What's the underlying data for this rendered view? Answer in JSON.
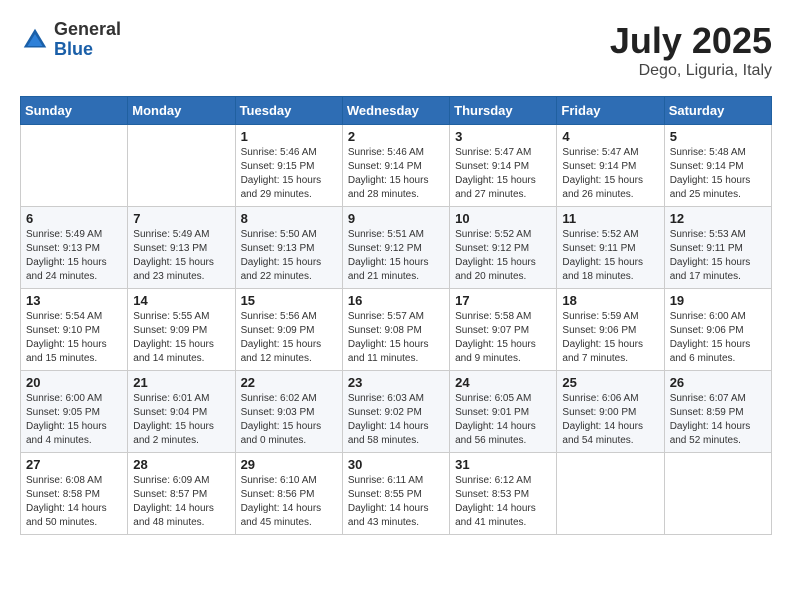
{
  "header": {
    "logo_general": "General",
    "logo_blue": "Blue",
    "main_title": "July 2025",
    "subtitle": "Dego, Liguria, Italy"
  },
  "weekdays": [
    "Sunday",
    "Monday",
    "Tuesday",
    "Wednesday",
    "Thursday",
    "Friday",
    "Saturday"
  ],
  "weeks": [
    [
      {
        "day": "",
        "info": ""
      },
      {
        "day": "",
        "info": ""
      },
      {
        "day": "1",
        "info": "Sunrise: 5:46 AM\nSunset: 9:15 PM\nDaylight: 15 hours and 29 minutes."
      },
      {
        "day": "2",
        "info": "Sunrise: 5:46 AM\nSunset: 9:14 PM\nDaylight: 15 hours and 28 minutes."
      },
      {
        "day": "3",
        "info": "Sunrise: 5:47 AM\nSunset: 9:14 PM\nDaylight: 15 hours and 27 minutes."
      },
      {
        "day": "4",
        "info": "Sunrise: 5:47 AM\nSunset: 9:14 PM\nDaylight: 15 hours and 26 minutes."
      },
      {
        "day": "5",
        "info": "Sunrise: 5:48 AM\nSunset: 9:14 PM\nDaylight: 15 hours and 25 minutes."
      }
    ],
    [
      {
        "day": "6",
        "info": "Sunrise: 5:49 AM\nSunset: 9:13 PM\nDaylight: 15 hours and 24 minutes."
      },
      {
        "day": "7",
        "info": "Sunrise: 5:49 AM\nSunset: 9:13 PM\nDaylight: 15 hours and 23 minutes."
      },
      {
        "day": "8",
        "info": "Sunrise: 5:50 AM\nSunset: 9:13 PM\nDaylight: 15 hours and 22 minutes."
      },
      {
        "day": "9",
        "info": "Sunrise: 5:51 AM\nSunset: 9:12 PM\nDaylight: 15 hours and 21 minutes."
      },
      {
        "day": "10",
        "info": "Sunrise: 5:52 AM\nSunset: 9:12 PM\nDaylight: 15 hours and 20 minutes."
      },
      {
        "day": "11",
        "info": "Sunrise: 5:52 AM\nSunset: 9:11 PM\nDaylight: 15 hours and 18 minutes."
      },
      {
        "day": "12",
        "info": "Sunrise: 5:53 AM\nSunset: 9:11 PM\nDaylight: 15 hours and 17 minutes."
      }
    ],
    [
      {
        "day": "13",
        "info": "Sunrise: 5:54 AM\nSunset: 9:10 PM\nDaylight: 15 hours and 15 minutes."
      },
      {
        "day": "14",
        "info": "Sunrise: 5:55 AM\nSunset: 9:09 PM\nDaylight: 15 hours and 14 minutes."
      },
      {
        "day": "15",
        "info": "Sunrise: 5:56 AM\nSunset: 9:09 PM\nDaylight: 15 hours and 12 minutes."
      },
      {
        "day": "16",
        "info": "Sunrise: 5:57 AM\nSunset: 9:08 PM\nDaylight: 15 hours and 11 minutes."
      },
      {
        "day": "17",
        "info": "Sunrise: 5:58 AM\nSunset: 9:07 PM\nDaylight: 15 hours and 9 minutes."
      },
      {
        "day": "18",
        "info": "Sunrise: 5:59 AM\nSunset: 9:06 PM\nDaylight: 15 hours and 7 minutes."
      },
      {
        "day": "19",
        "info": "Sunrise: 6:00 AM\nSunset: 9:06 PM\nDaylight: 15 hours and 6 minutes."
      }
    ],
    [
      {
        "day": "20",
        "info": "Sunrise: 6:00 AM\nSunset: 9:05 PM\nDaylight: 15 hours and 4 minutes."
      },
      {
        "day": "21",
        "info": "Sunrise: 6:01 AM\nSunset: 9:04 PM\nDaylight: 15 hours and 2 minutes."
      },
      {
        "day": "22",
        "info": "Sunrise: 6:02 AM\nSunset: 9:03 PM\nDaylight: 15 hours and 0 minutes."
      },
      {
        "day": "23",
        "info": "Sunrise: 6:03 AM\nSunset: 9:02 PM\nDaylight: 14 hours and 58 minutes."
      },
      {
        "day": "24",
        "info": "Sunrise: 6:05 AM\nSunset: 9:01 PM\nDaylight: 14 hours and 56 minutes."
      },
      {
        "day": "25",
        "info": "Sunrise: 6:06 AM\nSunset: 9:00 PM\nDaylight: 14 hours and 54 minutes."
      },
      {
        "day": "26",
        "info": "Sunrise: 6:07 AM\nSunset: 8:59 PM\nDaylight: 14 hours and 52 minutes."
      }
    ],
    [
      {
        "day": "27",
        "info": "Sunrise: 6:08 AM\nSunset: 8:58 PM\nDaylight: 14 hours and 50 minutes."
      },
      {
        "day": "28",
        "info": "Sunrise: 6:09 AM\nSunset: 8:57 PM\nDaylight: 14 hours and 48 minutes."
      },
      {
        "day": "29",
        "info": "Sunrise: 6:10 AM\nSunset: 8:56 PM\nDaylight: 14 hours and 45 minutes."
      },
      {
        "day": "30",
        "info": "Sunrise: 6:11 AM\nSunset: 8:55 PM\nDaylight: 14 hours and 43 minutes."
      },
      {
        "day": "31",
        "info": "Sunrise: 6:12 AM\nSunset: 8:53 PM\nDaylight: 14 hours and 41 minutes."
      },
      {
        "day": "",
        "info": ""
      },
      {
        "day": "",
        "info": ""
      }
    ]
  ]
}
